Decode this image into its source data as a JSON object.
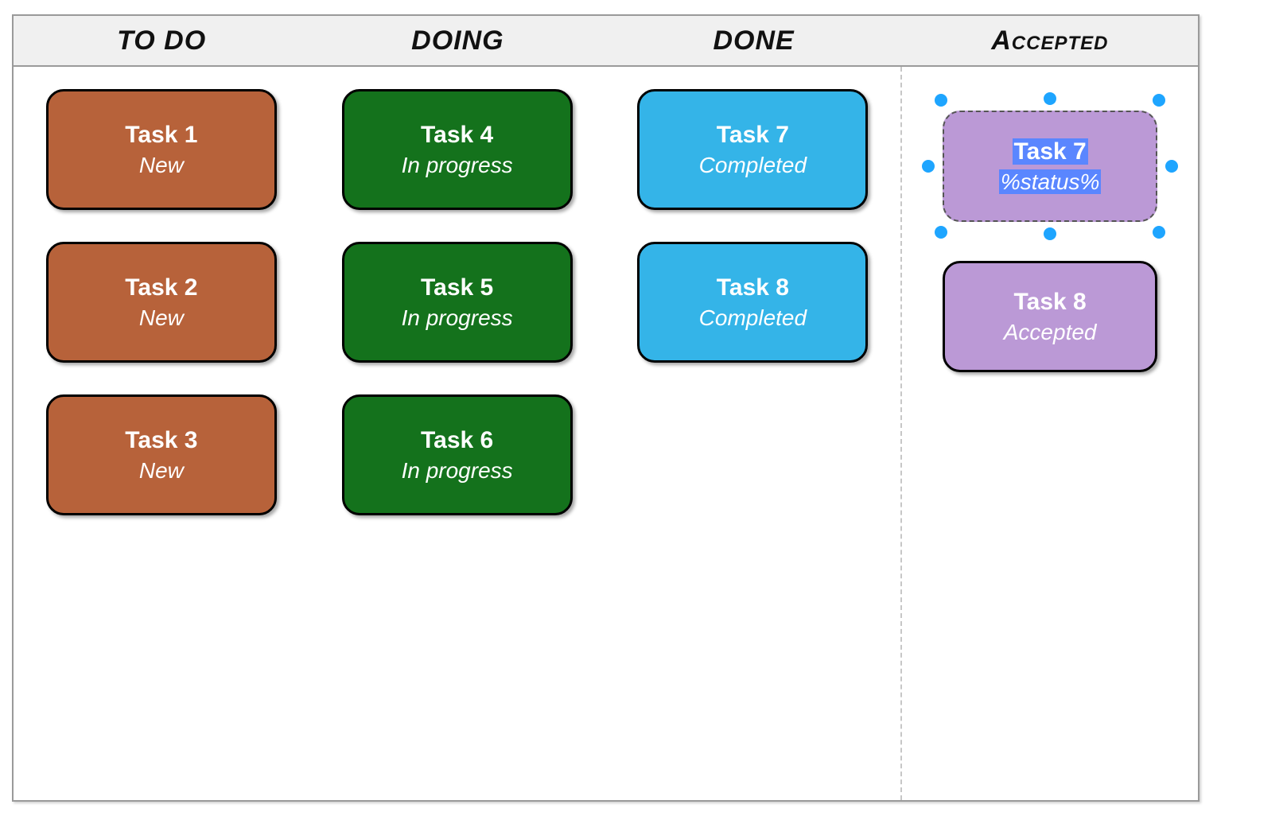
{
  "columns": [
    {
      "key": "todo",
      "header": "TO DO"
    },
    {
      "key": "doing",
      "header": "DOING"
    },
    {
      "key": "done",
      "header": "DONE"
    },
    {
      "key": "accepted",
      "header": "Accepted"
    }
  ],
  "lanes": {
    "todo": [
      {
        "title": "Task 1",
        "status": "New"
      },
      {
        "title": "Task 2",
        "status": "New"
      },
      {
        "title": "Task 3",
        "status": "New"
      }
    ],
    "doing": [
      {
        "title": "Task 4",
        "status": "In progress"
      },
      {
        "title": "Task 5",
        "status": "In progress"
      },
      {
        "title": "Task 6",
        "status": "In progress"
      }
    ],
    "done": [
      {
        "title": "Task 7",
        "status": "Completed"
      },
      {
        "title": "Task 8",
        "status": "Completed"
      }
    ],
    "accepted": [
      {
        "title": "Task 7",
        "status": "%status%",
        "selected": true
      },
      {
        "title": "Task 8",
        "status": "Accepted"
      }
    ]
  },
  "colors": {
    "todo": "#b7623a",
    "doing": "#14721c",
    "done": "#34b4e8",
    "accepted": "#bb99d6",
    "selection_handle": "#1ea5ff",
    "board_border": "#9a9a9a"
  }
}
